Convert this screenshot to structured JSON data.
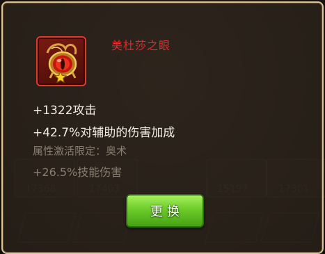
{
  "item": {
    "name": "美杜莎之眼",
    "icon": "medusa-eye-amulet-icon",
    "star_icon": "star-icon"
  },
  "stats": {
    "attack": "+1322攻击",
    "assist_damage_bonus": "+42.7%对辅助的伤害加成",
    "activation_requirement": "属性激活限定：奥术",
    "skill_damage": "+26.5%技能伤害"
  },
  "actions": {
    "change_label": "更换"
  },
  "background": {
    "slot_values": [
      "17368",
      "17403",
      "15197",
      "17301"
    ]
  },
  "colors": {
    "item_name": "#e62a2a",
    "button_green": "#6dcb2a",
    "panel_border": "#d9c39a"
  }
}
